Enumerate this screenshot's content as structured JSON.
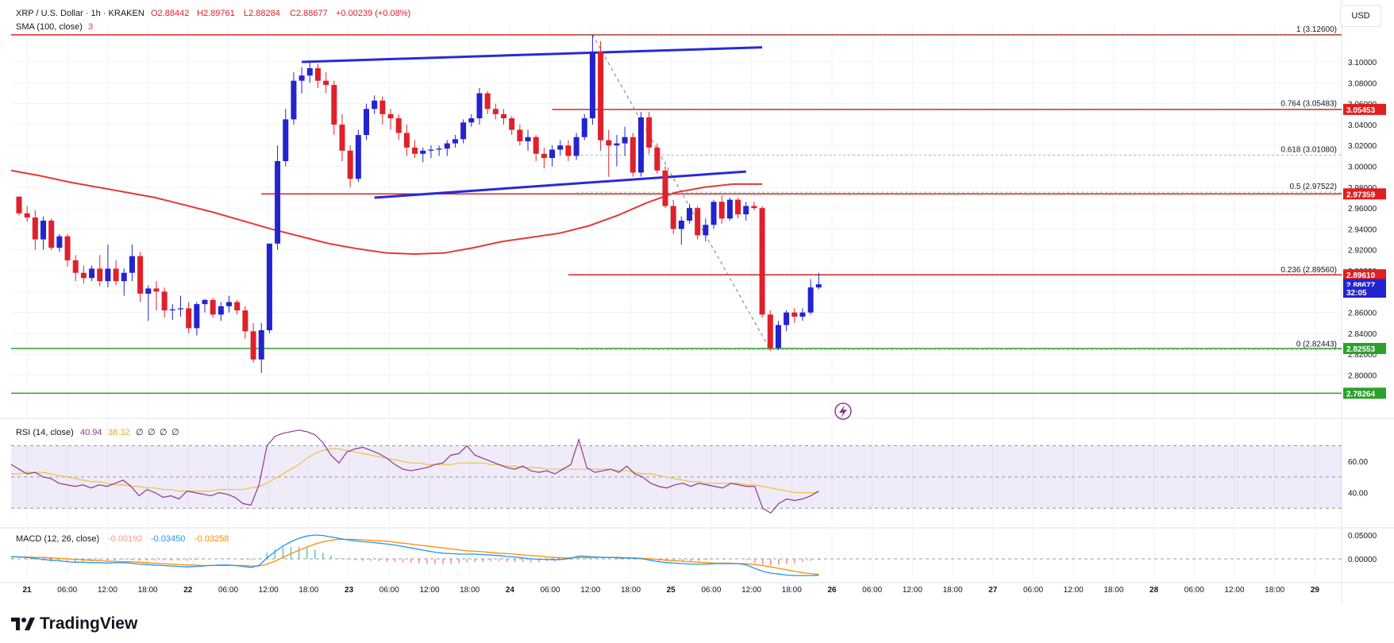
{
  "header": {
    "symbol": "XRP / U.S. Dollar · 1h · KRAKEN",
    "open": "O2.88442",
    "high": "H2.89761",
    "low": "L2.88284",
    "close": "C2.88677",
    "change": "+0.00239 (+0.08%)",
    "sma_label": "SMA (100, close)",
    "sma_suffix": "3"
  },
  "currency_button": "USD",
  "brand": "TradingView",
  "colors": {
    "up": "#2323cf",
    "down": "#e0202a",
    "sma": "#e53935",
    "trendline": "#2a2ad6",
    "support": "#2ca02c",
    "resistance": "#e02020",
    "rsi": "#8e3a8e",
    "rsi_ma": "#f0c040",
    "macd": "#2196f3",
    "signal": "#ff8c00",
    "hist_up": "#26a69a",
    "hist_down": "#ef5350"
  },
  "chart_data": {
    "type": "candlestick",
    "price_axis": {
      "ticks": [
        "3.10000",
        "3.08000",
        "3.06000",
        "3.04000",
        "3.02000",
        "3.00000",
        "2.98000",
        "2.96000",
        "2.94000",
        "2.92000",
        "2.90000",
        "2.88000",
        "2.86000",
        "2.84000",
        "2.82000",
        "2.80000"
      ],
      "ylim": [
        2.77,
        3.135
      ]
    },
    "time_axis": {
      "labels": [
        "21",
        "06:00",
        "12:00",
        "18:00",
        "22",
        "06:00",
        "12:00",
        "18:00",
        "23",
        "06:00",
        "12:00",
        "18:00",
        "24",
        "06:00",
        "12:00",
        "18:00",
        "25",
        "06:00",
        "12:00",
        "18:00",
        "26",
        "06:00",
        "12:00",
        "18:00",
        "27",
        "06:00",
        "12:00",
        "18:00",
        "28",
        "06:00",
        "12:00",
        "18:00",
        "29"
      ],
      "bold": [
        "21",
        "22",
        "23",
        "24",
        "25",
        "26",
        "27",
        "28",
        "29"
      ]
    },
    "price_tags": [
      {
        "text": "3.05453",
        "price": 3.05453,
        "color": "#e02020"
      },
      {
        "text": "2.97359",
        "price": 2.97359,
        "color": "#e02020"
      },
      {
        "text": "2.89610",
        "price": 2.8961,
        "color": "#e02020"
      },
      {
        "text": "2.88677",
        "price": 2.88677,
        "color": "#2323cf"
      },
      {
        "text": "32:05",
        "price": 2.8795,
        "color": "#2323cf"
      },
      {
        "text": "2.82553",
        "price": 2.82553,
        "color": "#2ca02c"
      },
      {
        "text": "2.78264",
        "price": 2.78264,
        "color": "#2ca02c"
      }
    ],
    "fib_levels": [
      {
        "label": "1 (3.12600)",
        "price": 3.126
      },
      {
        "label": "0.764 (3.05483)",
        "price": 3.05483
      },
      {
        "label": "0.618 (3.01080)",
        "price": 3.0108
      },
      {
        "label": "0.5 (2.97522)",
        "price": 2.97522
      },
      {
        "label": "0.236 (2.89560)",
        "price": 2.8956
      },
      {
        "label": "0 (2.82443)",
        "price": 2.82443
      }
    ],
    "candles": [
      [
        2.971,
        2.971,
        2.953,
        2.955
      ],
      [
        2.955,
        2.962,
        2.947,
        2.951
      ],
      [
        2.951,
        2.958,
        2.92,
        2.93
      ],
      [
        2.93,
        2.952,
        2.92,
        2.948
      ],
      [
        2.948,
        2.95,
        2.92,
        2.922
      ],
      [
        2.922,
        2.935,
        2.918,
        2.933
      ],
      [
        2.933,
        2.935,
        2.904,
        2.91
      ],
      [
        2.91,
        2.915,
        2.89,
        2.898
      ],
      [
        2.898,
        2.905,
        2.888,
        2.893
      ],
      [
        2.893,
        2.905,
        2.89,
        2.902
      ],
      [
        2.902,
        2.915,
        2.885,
        2.89
      ],
      [
        2.89,
        2.925,
        2.884,
        2.902
      ],
      [
        2.902,
        2.91,
        2.886,
        2.89
      ],
      [
        2.89,
        2.902,
        2.876,
        2.898
      ],
      [
        2.898,
        2.925,
        2.89,
        2.914
      ],
      [
        2.914,
        2.918,
        2.87,
        2.878
      ],
      [
        2.878,
        2.886,
        2.852,
        2.883
      ],
      [
        2.883,
        2.89,
        2.862,
        2.88
      ],
      [
        2.88,
        2.884,
        2.855,
        2.862
      ],
      [
        2.862,
        2.868,
        2.853,
        2.863
      ],
      [
        2.863,
        2.876,
        2.856,
        2.864
      ],
      [
        2.864,
        2.87,
        2.84,
        2.845
      ],
      [
        2.845,
        2.87,
        2.838,
        2.868
      ],
      [
        2.868,
        2.873,
        2.86,
        2.872
      ],
      [
        2.872,
        2.874,
        2.855,
        2.858
      ],
      [
        2.858,
        2.87,
        2.852,
        2.866
      ],
      [
        2.866,
        2.876,
        2.86,
        2.87
      ],
      [
        2.87,
        2.872,
        2.858,
        2.862
      ],
      [
        2.862,
        2.866,
        2.835,
        2.842
      ],
      [
        2.842,
        2.85,
        2.812,
        2.815
      ],
      [
        2.815,
        2.85,
        2.802,
        2.843
      ],
      [
        2.843,
        2.925,
        2.84,
        2.926
      ],
      [
        2.926,
        3.02,
        2.92,
        3.005
      ],
      [
        3.005,
        3.055,
        3.0,
        3.045
      ],
      [
        3.045,
        3.09,
        3.04,
        3.082
      ],
      [
        3.082,
        3.095,
        3.07,
        3.087
      ],
      [
        3.087,
        3.1,
        3.08,
        3.094
      ],
      [
        3.094,
        3.098,
        3.075,
        3.082
      ],
      [
        3.082,
        3.09,
        3.07,
        3.078
      ],
      [
        3.078,
        3.082,
        3.03,
        3.04
      ],
      [
        3.04,
        3.05,
        3.005,
        3.015
      ],
      [
        3.015,
        3.02,
        2.98,
        2.988
      ],
      [
        2.988,
        3.035,
        2.985,
        3.03
      ],
      [
        3.03,
        3.06,
        3.025,
        3.055
      ],
      [
        3.055,
        3.068,
        3.05,
        3.063
      ],
      [
        3.063,
        3.067,
        3.04,
        3.05
      ],
      [
        3.05,
        3.055,
        3.035,
        3.046
      ],
      [
        3.046,
        3.05,
        3.025,
        3.032
      ],
      [
        3.032,
        3.04,
        3.01,
        3.018
      ],
      [
        3.018,
        3.025,
        3.008,
        3.012
      ],
      [
        3.012,
        3.018,
        3.004,
        3.015
      ],
      [
        3.015,
        3.02,
        3.008,
        3.016
      ],
      [
        3.016,
        3.02,
        3.01,
        3.017
      ],
      [
        3.017,
        3.025,
        3.01,
        3.022
      ],
      [
        3.022,
        3.03,
        3.018,
        3.026
      ],
      [
        3.026,
        3.045,
        3.022,
        3.042
      ],
      [
        3.042,
        3.05,
        3.038,
        3.046
      ],
      [
        3.046,
        3.075,
        3.04,
        3.07
      ],
      [
        3.07,
        3.072,
        3.05,
        3.055
      ],
      [
        3.055,
        3.06,
        3.045,
        3.05
      ],
      [
        3.05,
        3.055,
        3.04,
        3.046
      ],
      [
        3.046,
        3.048,
        3.03,
        3.035
      ],
      [
        3.035,
        3.04,
        3.02,
        3.024
      ],
      [
        3.024,
        3.035,
        3.015,
        3.028
      ],
      [
        3.028,
        3.03,
        3.005,
        3.012
      ],
      [
        3.012,
        3.018,
        2.998,
        3.008
      ],
      [
        3.008,
        3.02,
        3.0,
        3.016
      ],
      [
        3.016,
        3.025,
        3.01,
        3.02
      ],
      [
        3.02,
        3.025,
        3.005,
        3.01
      ],
      [
        3.01,
        3.032,
        3.006,
        3.028
      ],
      [
        3.028,
        3.05,
        3.025,
        3.046
      ],
      [
        3.046,
        3.126,
        3.04,
        3.11
      ],
      [
        3.11,
        3.12,
        3.015,
        3.025
      ],
      [
        3.025,
        3.035,
        2.99,
        3.02
      ],
      [
        3.02,
        3.03,
        3.0,
        3.022
      ],
      [
        3.022,
        3.038,
        3.01,
        3.028
      ],
      [
        3.028,
        3.032,
        2.99,
        2.994
      ],
      [
        2.994,
        3.052,
        2.99,
        3.047
      ],
      [
        3.047,
        3.052,
        3.012,
        3.018
      ],
      [
        3.018,
        3.022,
        2.993,
        2.996
      ],
      [
        2.996,
        3.0,
        2.96,
        2.962
      ],
      [
        2.962,
        2.968,
        2.935,
        2.94
      ],
      [
        2.94,
        2.952,
        2.925,
        2.948
      ],
      [
        2.948,
        2.964,
        2.945,
        2.96
      ],
      [
        2.96,
        2.962,
        2.93,
        2.934
      ],
      [
        2.934,
        2.95,
        2.928,
        2.944
      ],
      [
        2.944,
        2.968,
        2.94,
        2.966
      ],
      [
        2.966,
        2.972,
        2.945,
        2.95
      ],
      [
        2.95,
        2.97,
        2.948,
        2.968
      ],
      [
        2.968,
        2.97,
        2.95,
        2.954
      ],
      [
        2.954,
        2.966,
        2.948,
        2.962
      ],
      [
        2.962,
        2.966,
        2.958,
        2.96
      ],
      [
        2.96,
        2.962,
        2.855,
        2.858
      ],
      [
        2.858,
        2.862,
        2.823,
        2.826
      ],
      [
        2.826,
        2.852,
        2.824,
        2.848
      ],
      [
        2.848,
        2.862,
        2.842,
        2.86
      ],
      [
        2.86,
        2.864,
        2.85,
        2.856
      ],
      [
        2.856,
        2.864,
        2.852,
        2.86
      ],
      [
        2.86,
        2.892,
        2.858,
        2.884
      ],
      [
        2.884,
        2.898,
        2.882,
        2.887
      ]
    ],
    "sma": [
      2.996,
      2.991,
      2.985,
      2.98,
      2.975,
      2.97,
      2.963,
      2.956,
      2.948,
      2.94,
      2.933,
      2.926,
      2.921,
      2.917,
      2.916,
      2.917,
      2.922,
      2.928,
      2.932,
      2.936,
      2.943,
      2.953,
      2.965,
      2.975,
      2.98,
      2.983,
      2.983
    ],
    "trendlines": [
      {
        "from": [
          35,
          3.1
        ],
        "to": [
          92,
          3.114
        ]
      },
      {
        "from": [
          44,
          2.97
        ],
        "to": [
          90,
          2.995
        ]
      }
    ],
    "horizontal_lines": [
      {
        "price": 3.126,
        "from": 0,
        "to": 99,
        "color": "#e02020"
      },
      {
        "price": 3.05453,
        "from": 66,
        "to": 99,
        "color": "#e02020"
      },
      {
        "price": 2.97359,
        "from": 30,
        "to": 99,
        "color": "#e02020"
      },
      {
        "price": 2.8961,
        "from": 68,
        "to": 99,
        "color": "#e02020"
      },
      {
        "price": 2.82553,
        "from": 0,
        "to": 99,
        "color": "#2ca02c"
      },
      {
        "price": 2.78264,
        "from": 0,
        "to": 99,
        "color": "#2ca02c"
      }
    ],
    "rsi": {
      "label": "RSI (14, close)",
      "value": "40.94",
      "ma_value": "38.32",
      "extras": [
        "∅",
        "∅",
        "∅",
        "∅"
      ],
      "ticks": [
        "60.00",
        "40.00"
      ],
      "band": [
        30,
        70
      ],
      "mid": 50,
      "values": [
        58,
        55,
        52,
        53,
        50,
        49,
        46,
        45,
        44,
        45,
        43,
        45,
        44,
        46,
        48,
        44,
        38,
        42,
        40,
        37,
        38,
        36,
        41,
        40,
        39,
        38,
        40,
        39,
        37,
        33,
        32,
        45,
        70,
        76,
        78,
        79,
        80,
        79,
        77,
        72,
        64,
        59,
        66,
        68,
        69,
        67,
        65,
        62,
        58,
        55,
        54,
        55,
        56,
        58,
        59,
        64,
        65,
        70,
        64,
        62,
        60,
        58,
        56,
        55,
        57,
        54,
        53,
        54,
        52,
        55,
        58,
        74,
        56,
        53,
        54,
        55,
        53,
        57,
        52,
        50,
        46,
        44,
        43,
        45,
        46,
        44,
        46,
        45,
        44,
        43,
        46,
        45,
        44,
        44,
        30,
        27,
        33,
        36,
        35,
        36,
        38,
        41
      ],
      "ma": [
        52,
        52,
        53,
        53,
        53,
        52,
        51,
        50,
        49,
        48,
        47,
        47,
        46,
        45,
        45,
        44,
        44,
        43,
        43,
        42,
        42,
        41,
        41,
        41,
        41,
        41,
        42,
        42,
        42,
        42,
        43,
        44,
        46,
        49,
        52,
        55,
        58,
        62,
        65,
        67,
        68,
        68,
        67,
        66,
        65,
        64,
        63,
        62,
        61,
        60,
        59,
        59,
        58,
        58,
        58,
        58,
        59,
        59,
        59,
        59,
        58,
        58,
        57,
        57,
        56,
        56,
        56,
        55,
        55,
        55,
        55,
        55,
        55,
        55,
        55,
        55,
        54,
        54,
        53,
        52,
        52,
        51,
        50,
        49,
        48,
        47,
        47,
        46,
        46,
        46,
        46,
        46,
        45,
        45,
        44,
        43,
        42,
        41,
        40,
        40,
        40,
        40
      ],
      "ylim": [
        20,
        85
      ]
    },
    "macd": {
      "label": "MACD (12, 26, close)",
      "hist_value": "-0.00192",
      "macd_value": "-0.03450",
      "signal_value": "-0.03258",
      "ticks": [
        "0.05000",
        "0.00000"
      ],
      "macd": [
        0.005,
        0.004,
        0.003,
        0.001,
        -0.001,
        -0.003,
        -0.004,
        -0.006,
        -0.007,
        -0.007,
        -0.008,
        -0.008,
        -0.009,
        -0.008,
        -0.008,
        -0.009,
        -0.011,
        -0.012,
        -0.013,
        -0.014,
        -0.015,
        -0.016,
        -0.017,
        -0.016,
        -0.015,
        -0.014,
        -0.013,
        -0.013,
        -0.014,
        -0.016,
        -0.018,
        -0.014,
        0.002,
        0.015,
        0.027,
        0.036,
        0.043,
        0.048,
        0.05,
        0.049,
        0.046,
        0.043,
        0.04,
        0.038,
        0.036,
        0.035,
        0.033,
        0.031,
        0.029,
        0.026,
        0.023,
        0.02,
        0.017,
        0.014,
        0.012,
        0.011,
        0.01,
        0.01,
        0.01,
        0.009,
        0.008,
        0.007,
        0.005,
        0.004,
        0.002,
        0.0,
        -0.001,
        -0.001,
        -0.002,
        -0.001,
        0.001,
        0.006,
        0.005,
        0.004,
        0.003,
        0.003,
        0.002,
        0.002,
        0.001,
        0.0,
        -0.003,
        -0.006,
        -0.008,
        -0.009,
        -0.01,
        -0.011,
        -0.011,
        -0.011,
        -0.01,
        -0.01,
        -0.01,
        -0.01,
        -0.013,
        -0.02,
        -0.026,
        -0.03,
        -0.032,
        -0.034,
        -0.035,
        -0.035,
        -0.035,
        -0.0345
      ],
      "signal": [
        0.004,
        0.004,
        0.004,
        0.003,
        0.003,
        0.002,
        0.001,
        0.0,
        -0.001,
        -0.002,
        -0.003,
        -0.004,
        -0.005,
        -0.005,
        -0.006,
        -0.006,
        -0.007,
        -0.008,
        -0.009,
        -0.01,
        -0.011,
        -0.012,
        -0.013,
        -0.013,
        -0.014,
        -0.014,
        -0.014,
        -0.014,
        -0.014,
        -0.014,
        -0.015,
        -0.015,
        -0.011,
        -0.005,
        0.003,
        0.011,
        0.018,
        0.025,
        0.031,
        0.036,
        0.039,
        0.041,
        0.041,
        0.041,
        0.04,
        0.039,
        0.038,
        0.037,
        0.035,
        0.033,
        0.031,
        0.029,
        0.027,
        0.025,
        0.023,
        0.021,
        0.019,
        0.017,
        0.016,
        0.015,
        0.013,
        0.012,
        0.011,
        0.01,
        0.008,
        0.007,
        0.006,
        0.004,
        0.003,
        0.002,
        0.002,
        0.003,
        0.003,
        0.003,
        0.003,
        0.003,
        0.003,
        0.002,
        0.002,
        0.001,
        0.0,
        -0.001,
        -0.003,
        -0.004,
        -0.005,
        -0.006,
        -0.007,
        -0.008,
        -0.009,
        -0.009,
        -0.009,
        -0.01,
        -0.01,
        -0.012,
        -0.014,
        -0.017,
        -0.02,
        -0.023,
        -0.026,
        -0.029,
        -0.031,
        -0.03258
      ],
      "ylim": [
        -0.04,
        0.065
      ]
    }
  }
}
